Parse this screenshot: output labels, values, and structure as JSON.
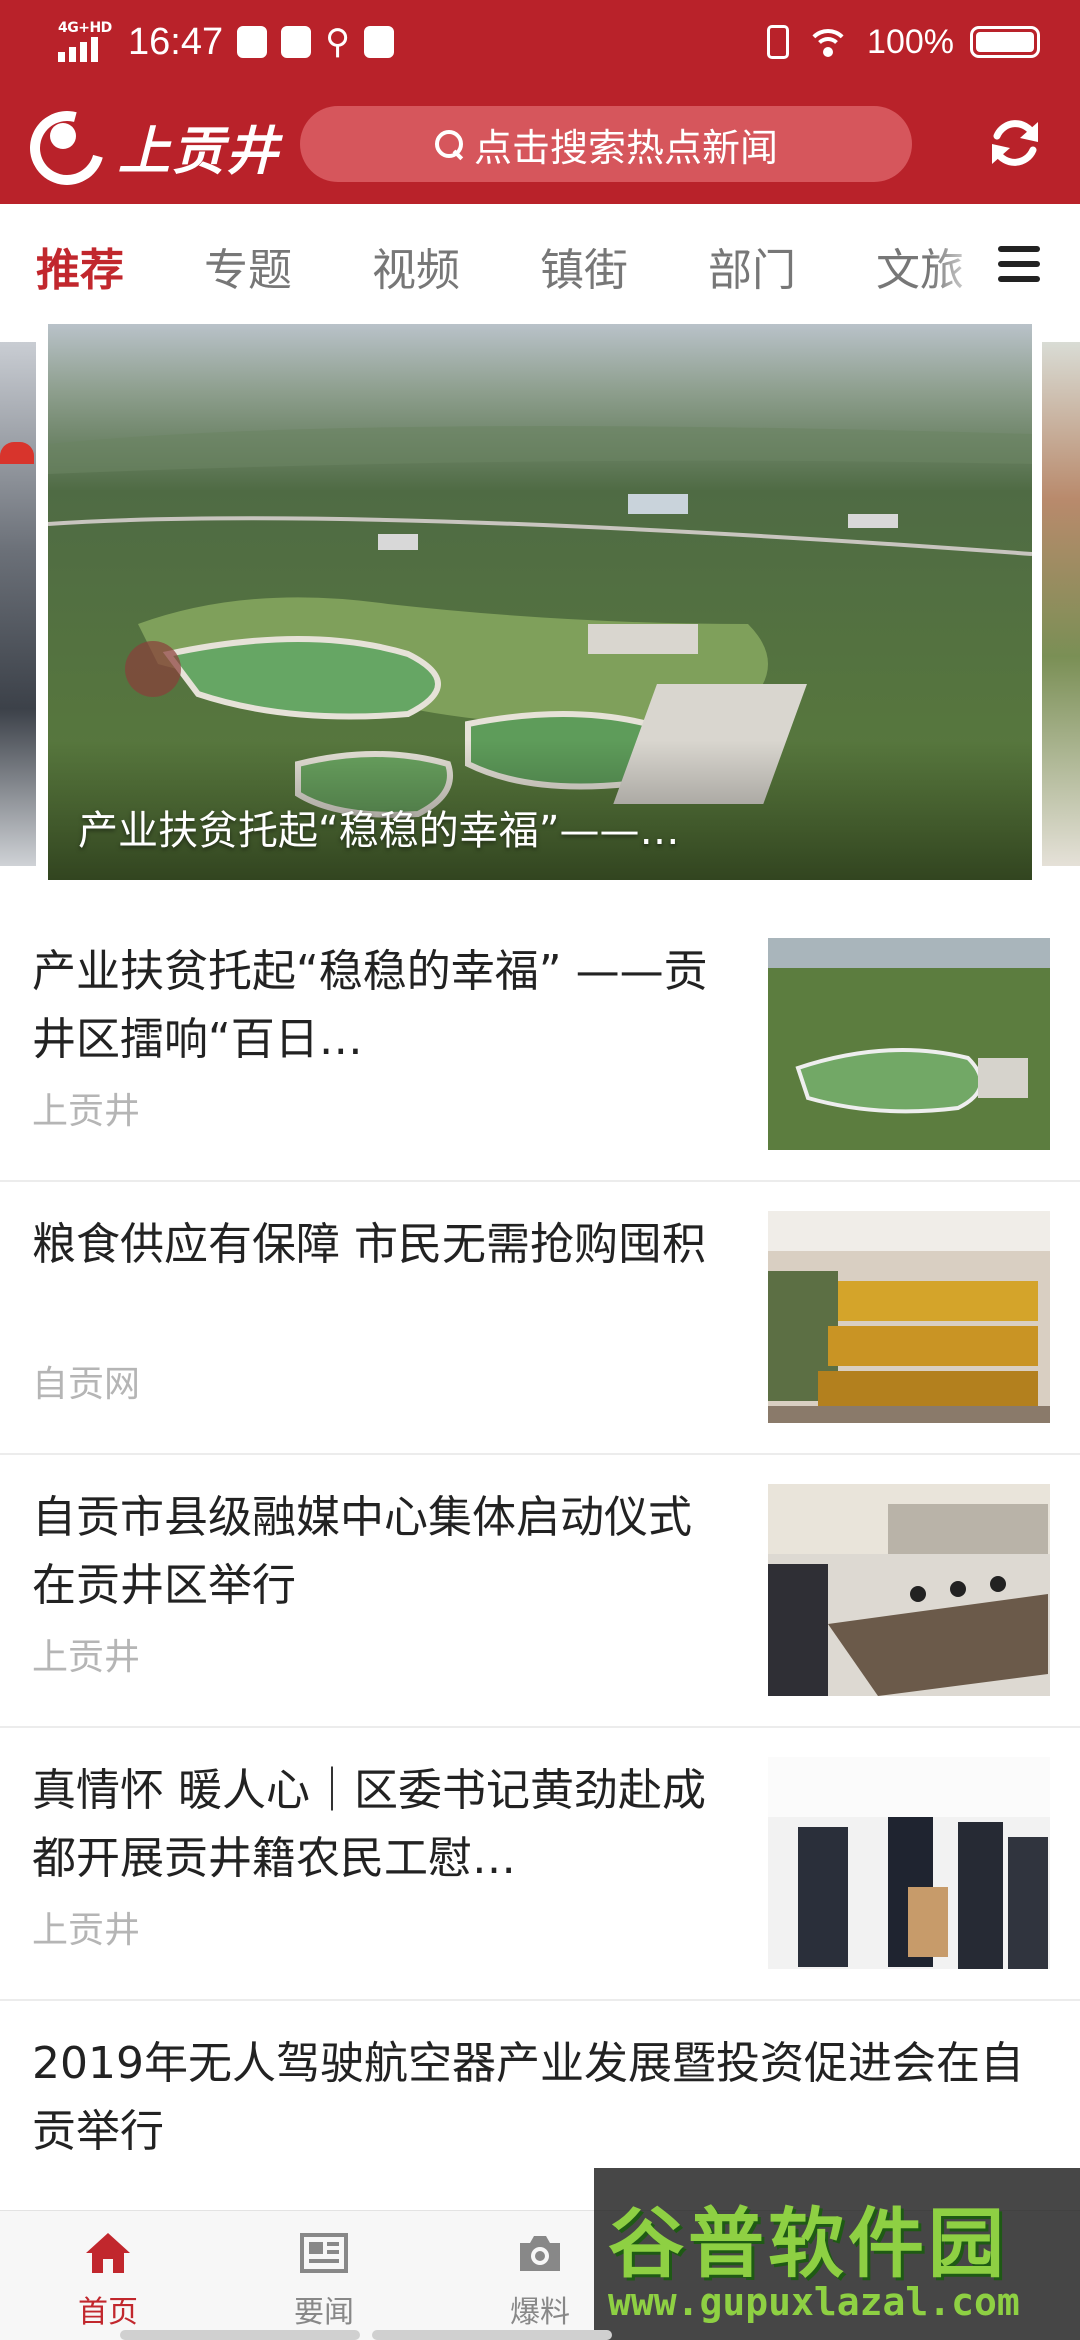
{
  "status_bar": {
    "network": "4G+HD",
    "time": "16:47",
    "battery": "100%"
  },
  "header": {
    "logo_text": "上贡井",
    "search_placeholder": "点击搜索热点新闻",
    "colors": {
      "brand_red": "#b9222a",
      "search_bg": "#d6565c"
    }
  },
  "tabs": [
    {
      "label": "推荐",
      "active": true
    },
    {
      "label": "专题",
      "active": false
    },
    {
      "label": "视频",
      "active": false
    },
    {
      "label": "镇街",
      "active": false
    },
    {
      "label": "部门",
      "active": false
    },
    {
      "label": "文旅",
      "active": false
    }
  ],
  "carousel": {
    "caption": "产业扶贫托起“稳稳的幸福”——…"
  },
  "news": [
    {
      "title": "产业扶贫托起“稳稳的幸福” ——贡井区擂响“百日…",
      "source": "上贡井",
      "thumb": "aerial-farmland"
    },
    {
      "title": "粮食供应有保障 市民无需抢购囤积",
      "source": "自贡网",
      "thumb": "supermarket-shelves"
    },
    {
      "title": "自贡市县级融媒中心集体启动仪式在贡井区举行",
      "source": "上贡井",
      "thumb": "meeting-room"
    },
    {
      "title": "真情怀 暖人心｜区委书记黄劲赴成都开展贡井籍农民工慰…",
      "source": "上贡井",
      "thumb": "officials-visit"
    },
    {
      "title": "2019年无人驾驶航空器产业发展暨投资促进会在自贡举行",
      "source": "",
      "thumb": ""
    }
  ],
  "bottom_nav": [
    {
      "label": "首页",
      "icon": "home-icon",
      "active": true
    },
    {
      "label": "要闻",
      "icon": "newspaper-icon",
      "active": false
    },
    {
      "label": "爆料",
      "icon": "camera-icon",
      "active": false
    }
  ],
  "watermark": {
    "title": "谷普软件园",
    "url": "www.gupuxlazal.com"
  }
}
